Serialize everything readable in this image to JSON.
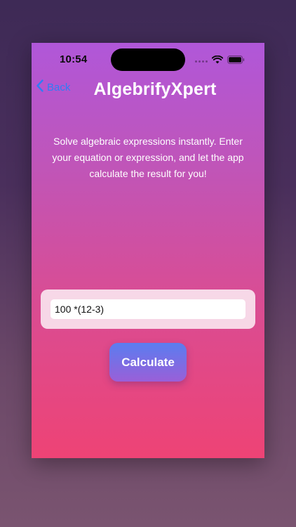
{
  "status_bar": {
    "time": "10:54"
  },
  "nav": {
    "back_label": "Back",
    "title": "AlgebrifyXpert"
  },
  "main": {
    "description": "Solve algebraic expressions instantly. Enter your equation or expression, and let the app calculate the result for you!",
    "expression_value": "100 *(12-3)",
    "calculate_label": "Calculate"
  },
  "colors": {
    "accent": "#2f7cf6",
    "gradient_top": "#b057d9",
    "gradient_bottom": "#ee4375"
  }
}
